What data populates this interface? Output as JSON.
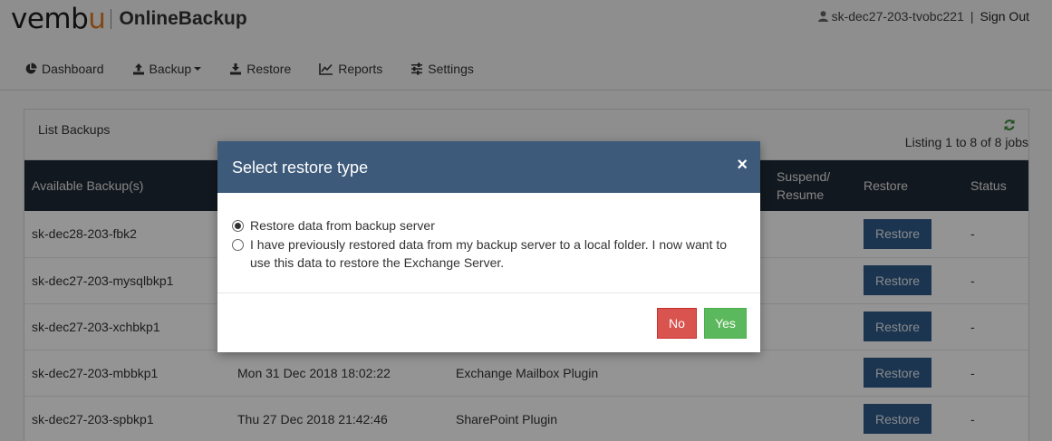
{
  "header": {
    "logo_brand": "vemb",
    "logo_brand_accent": "u",
    "logo_product": "OnlineBackup",
    "user": "sk-dec27-203-tvobc221",
    "separator": "|",
    "signout": "Sign Out"
  },
  "nav": [
    {
      "label": "Dashboard",
      "icon": "pie-chart-icon"
    },
    {
      "label": "Backup",
      "icon": "upload-icon"
    },
    {
      "label": "Restore",
      "icon": "download-icon"
    },
    {
      "label": "Reports",
      "icon": "line-chart-icon"
    },
    {
      "label": "Settings",
      "icon": "sliders-icon"
    }
  ],
  "panel": {
    "title": "List Backups",
    "listing": "Listing 1 to 8 of 8 jobs"
  },
  "table": {
    "columns": [
      "Available Backup(s)",
      "",
      "",
      "Suspend/ Resume",
      "Restore",
      "Status"
    ],
    "rows": [
      {
        "name": "sk-dec28-203-fbk2",
        "date": "",
        "plugin": "",
        "restore": "Restore",
        "status": "-"
      },
      {
        "name": "sk-dec27-203-mysqlbkp1",
        "date": "",
        "plugin": "",
        "restore": "Restore",
        "status": "-"
      },
      {
        "name": "sk-dec27-203-xchbkp1",
        "date": "",
        "plugin": "",
        "restore": "Restore",
        "status": "-"
      },
      {
        "name": "sk-dec27-203-mbbkp1",
        "date": "Mon 31 Dec 2018 18:02:22",
        "plugin": "Exchange Mailbox Plugin",
        "restore": "Restore",
        "status": "-"
      },
      {
        "name": "sk-dec27-203-spbkp1",
        "date": "Thu 27 Dec 2018 21:42:46",
        "plugin": "SharePoint Plugin",
        "restore": "Restore",
        "status": "-"
      }
    ]
  },
  "modal": {
    "title": "Select restore type",
    "close": "×",
    "options": [
      {
        "label": "Restore data from backup server",
        "selected": true
      },
      {
        "label": "I have previously restored data from my backup server to a local folder. I now want to use this data to restore the Exchange Server.",
        "selected": false
      }
    ],
    "no_label": "No",
    "yes_label": "Yes"
  },
  "colors": {
    "modal_header": "#3d5a7a",
    "table_header": "#1f2a36",
    "restore_button": "#2f5b88",
    "no_button": "#d9534f",
    "yes_button": "#5cb85c",
    "logo_accent": "#e07a25",
    "refresh_icon": "#3c8a3c"
  }
}
